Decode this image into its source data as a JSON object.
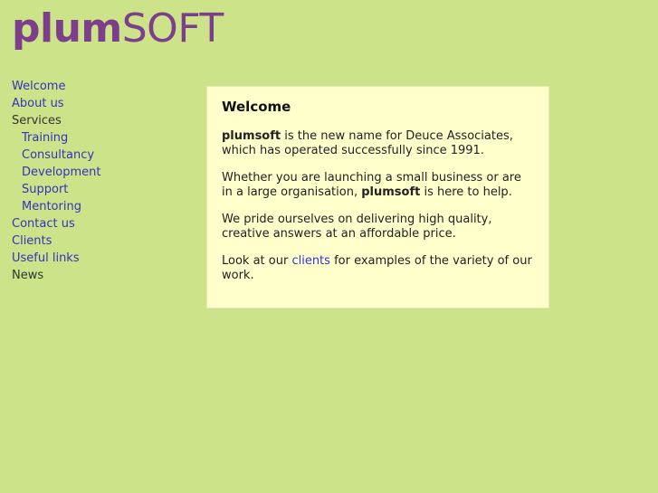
{
  "colors": {
    "page_background": "#cde389",
    "panel_background": "#ffffcc",
    "logo_purple": "#7b3f8c",
    "link_blue": "#3333bb",
    "plain_text": "#333333"
  },
  "header": {
    "logo_bold": "plum",
    "logo_light": "SOFT",
    "logo_full": "plumSOFT"
  },
  "sidebar": {
    "items": [
      {
        "label": "Welcome",
        "link": true,
        "sub": false
      },
      {
        "label": "About us",
        "link": true,
        "sub": false
      },
      {
        "label": "Services",
        "link": false,
        "sub": false
      },
      {
        "label": "Training",
        "link": true,
        "sub": true
      },
      {
        "label": "Consultancy",
        "link": true,
        "sub": true
      },
      {
        "label": "Development",
        "link": true,
        "sub": true
      },
      {
        "label": "Support",
        "link": true,
        "sub": true
      },
      {
        "label": "Mentoring",
        "link": true,
        "sub": true
      },
      {
        "label": "Contact us",
        "link": true,
        "sub": false
      },
      {
        "label": "Clients",
        "link": true,
        "sub": false
      },
      {
        "label": "Useful links",
        "link": true,
        "sub": false
      },
      {
        "label": "News",
        "link": false,
        "sub": false
      }
    ]
  },
  "main": {
    "title": "Welcome",
    "paragraphs": [
      {
        "parts": [
          {
            "text": "plumsoft",
            "style": "bold"
          },
          {
            "text": " is the new name for Deuce Associates, which has operated successfully since 1991.",
            "style": "normal"
          }
        ]
      },
      {
        "parts": [
          {
            "text": "Whether you are launching a small business or are in a large organisation, ",
            "style": "normal"
          },
          {
            "text": "plumsoft",
            "style": "bold"
          },
          {
            "text": " is here to help.",
            "style": "normal"
          }
        ]
      },
      {
        "parts": [
          {
            "text": "We pride ourselves on delivering high quality, creative answers at an affordable price.",
            "style": "normal"
          }
        ]
      },
      {
        "parts": [
          {
            "text": "Look at our ",
            "style": "normal"
          },
          {
            "text": "clients",
            "style": "link"
          },
          {
            "text": " for examples of the variety of our work.",
            "style": "normal"
          }
        ]
      }
    ]
  }
}
